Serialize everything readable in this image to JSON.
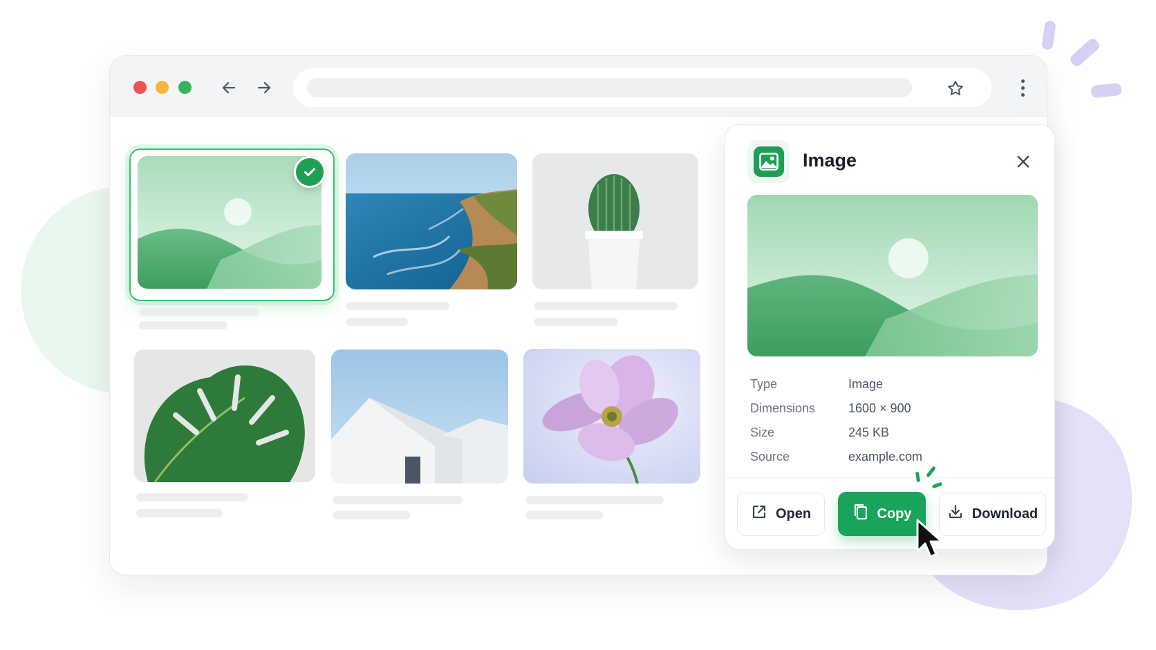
{
  "colors": {
    "accent": "#1aa35a",
    "selection_border": "#34c26b",
    "decor_purple": "#e5e1f8",
    "decor_green": "#e9f7ef"
  },
  "browser": {
    "window_controls": [
      "close-dot",
      "minimize-dot",
      "maximize-dot"
    ],
    "icons": [
      "back-arrow-icon",
      "forward-arrow-icon",
      "lock-icon",
      "star-icon",
      "more-vertical-icon"
    ],
    "url": ""
  },
  "gallery": {
    "items": [
      {
        "name": "placeholder-landscape",
        "selected": true
      },
      {
        "name": "coastline-photo",
        "selected": false
      },
      {
        "name": "cactus-photo",
        "selected": false
      },
      {
        "name": "monstera-leaf-photo",
        "selected": false
      },
      {
        "name": "white-building-photo",
        "selected": false
      },
      {
        "name": "pink-flower-photo",
        "selected": false
      }
    ]
  },
  "panel": {
    "title": "Image",
    "icon": "image-icon",
    "details": [
      {
        "key": "Type",
        "value": "Image"
      },
      {
        "key": "Dimensions",
        "value": "1600 × 900"
      },
      {
        "key": "Size",
        "value": "245 KB"
      },
      {
        "key": "Source",
        "value": "example.com"
      }
    ],
    "buttons": {
      "open": "Open",
      "copy": "Copy",
      "download": "Download"
    }
  }
}
